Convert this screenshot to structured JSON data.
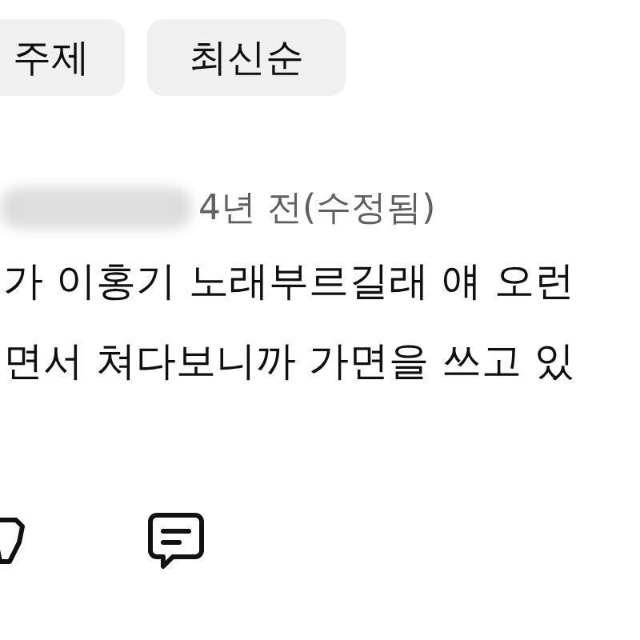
{
  "filter_chips": [
    {
      "label": "주제",
      "selected": false
    },
    {
      "label": "최신순",
      "selected": false
    }
  ],
  "comment": {
    "timestamp": "4년 전(수정됨)",
    "lines": [
      "가 이홍기 노래부르길래 얘 오런",
      "면서 쳐다보니까 가면을 쓰고 있"
    ]
  }
}
